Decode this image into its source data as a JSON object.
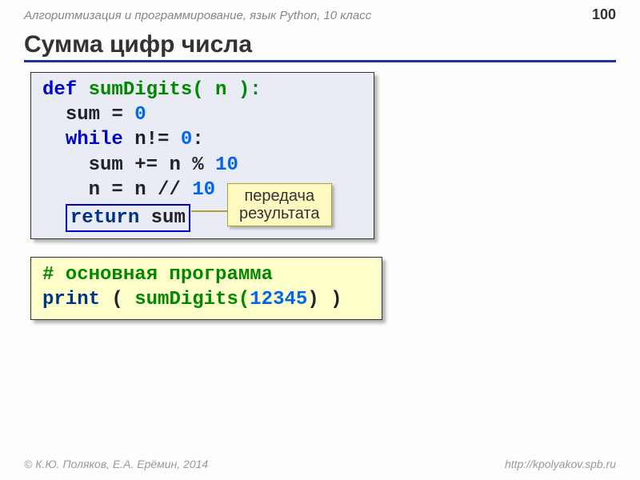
{
  "header": {
    "course_title": "Алгоритмизация и программирование, язык Python, 10 класс",
    "page_number": "100"
  },
  "title": "Сумма цифр числа",
  "code1": {
    "l1_def": "def",
    "l1_name": "sumDigits( n ):",
    "l2_a": "sum",
    "l2_b": "=",
    "l2_c": "0",
    "l3_while": "while",
    "l3_cond": "n!=",
    "l3_zero": "0",
    "l3_colon": ":",
    "l4_a": "sum +=",
    "l4_b": "n %",
    "l4_c": "10",
    "l5_a": "n =",
    "l5_b": "n //",
    "l5_c": "10",
    "l6_return": "return",
    "l6_sum": "sum"
  },
  "callout": {
    "line1": "передача",
    "line2": "результата"
  },
  "code2": {
    "comment": "# основная программа",
    "print": "print",
    "open": " (",
    "call": "sumDigits(",
    "arg": "12345",
    "close": ") )"
  },
  "footer": {
    "authors": "© К.Ю. Поляков, Е.А. Ерёмин, 2014",
    "url": "http://kpolyakov.spb.ru"
  }
}
